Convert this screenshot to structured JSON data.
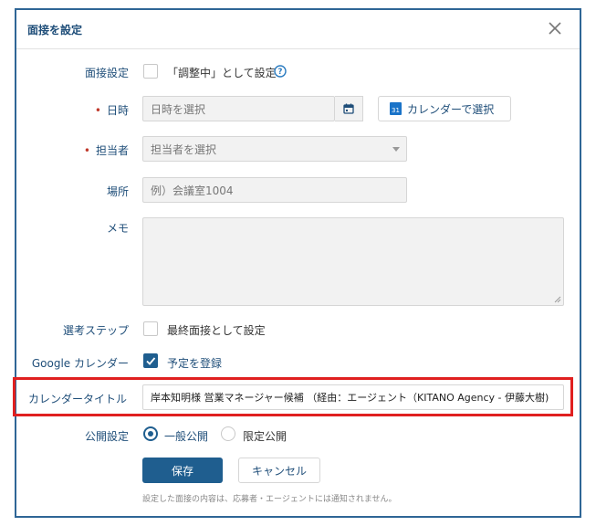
{
  "modal": {
    "title": "面接を設定",
    "close_icon": "close-icon"
  },
  "fields": {
    "interview_setting": {
      "label": "面接設定",
      "checkbox_label": "「調整中」として設定",
      "checked": false,
      "help_icon": "question-circle-icon"
    },
    "datetime": {
      "label": "日時",
      "required": true,
      "placeholder": "日時を選択",
      "calendar_icon": "calendar-icon",
      "calendar_button": "カレンダーで選択",
      "calendar_badge": "31"
    },
    "person_in_charge": {
      "label": "担当者",
      "required": true,
      "placeholder": "担当者を選択"
    },
    "location": {
      "label": "場所",
      "placeholder": "例）会議室1004"
    },
    "memo": {
      "label": "メモ",
      "value": ""
    },
    "selection_step": {
      "label": "選考ステップ",
      "checkbox_label": "最終面接として設定",
      "checked": false
    },
    "google_calendar": {
      "label": "Google カレンダー",
      "checkbox_label": "予定を登録",
      "checked": true
    },
    "calendar_title": {
      "label": "カレンダータイトル",
      "value": "岸本知明様 営業マネージャー候補 （経由：エージェント（KITANO Agency - 伊藤大樹)"
    },
    "visibility": {
      "label": "公開設定",
      "options": [
        "一般公開",
        "限定公開"
      ],
      "selected": "一般公開"
    }
  },
  "actions": {
    "save_label": "保存",
    "cancel_label": "キャンセル",
    "note": "設定した面接の内容は、応募者・エージェントには通知されません。"
  },
  "colors": {
    "primary": "#1f5e8f",
    "label": "#1f4e79",
    "required": "#c0392b",
    "highlight": "#e02020"
  }
}
